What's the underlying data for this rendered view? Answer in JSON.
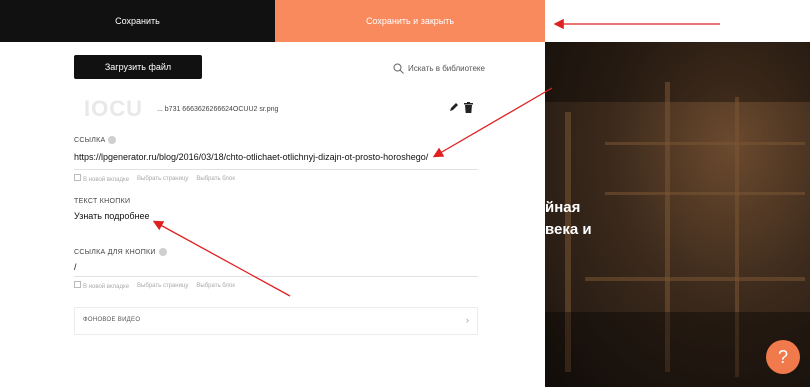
{
  "toolbar": {
    "save_label": "Сохранить",
    "save_close_label": "Сохранить и закрыть"
  },
  "editor": {
    "upload_label": "Загрузить файл",
    "library_label": "Искать в библиотеке",
    "file_name": "... b731 6663626266624OCUU2 sr.png",
    "link": {
      "label": "ССЫЛКА",
      "value": "https://lpgenerator.ru/blog/2016/03/18/chto-otlichaet-otlichnyj-dizajn-ot-prosto-horoshego/",
      "opt_new_tab": "В новой вкладке",
      "opt_pick_page": "Выбрать страницу",
      "opt_pick_block": "Выбрать блок"
    },
    "button_text": {
      "label": "ТЕКСТ КНОПКИ",
      "value": "Узнать подробнее"
    },
    "button_link": {
      "label": "ССЫЛКА ДЛЯ КНОПКИ",
      "value": "/",
      "opt_new_tab": "В новой вкладке",
      "opt_pick_page": "Выбрать страницу",
      "opt_pick_block": "Выбрать блок"
    },
    "background_video_label": "ФОНОВОЕ ВИДЕО"
  },
  "preview": {
    "hero_line1": "йная",
    "hero_line2": "века и"
  },
  "help_bubble": "?",
  "colors": {
    "accent": "#f98a5e",
    "dark": "#111111",
    "annotation_arrow": "#e02020"
  },
  "icons": [
    "search-icon",
    "pencil-icon",
    "trash-icon",
    "help-icon",
    "chevron-right-icon"
  ]
}
